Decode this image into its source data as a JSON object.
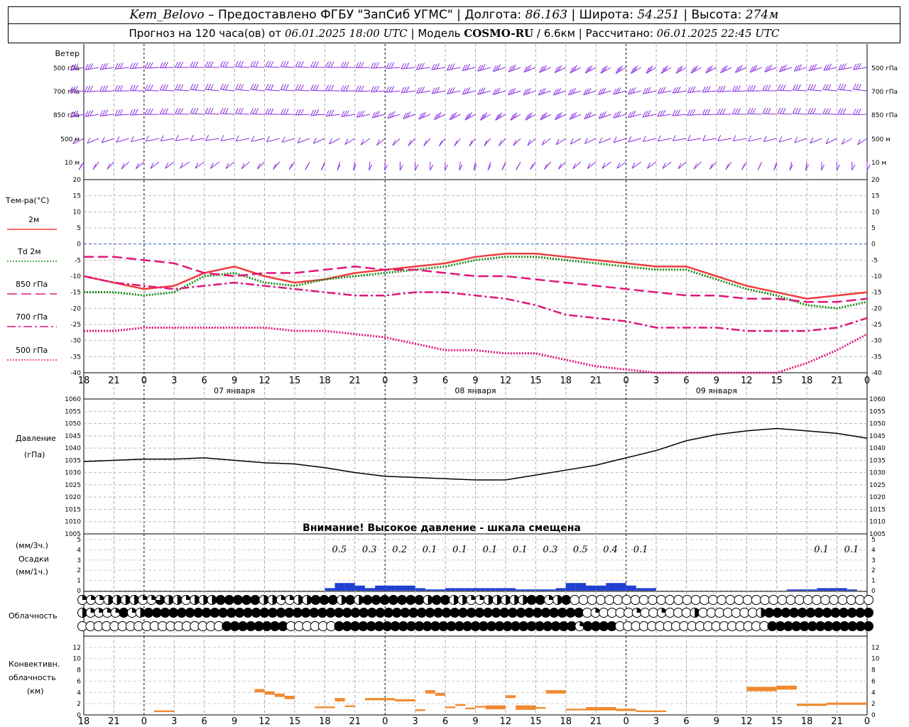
{
  "header": {
    "station": "Kem_Belovo",
    "provider": "– Предоставлено ФГБУ \"ЗапСиб УГМС\" |",
    "lon_label": "Долгота:",
    "lon": "86.163",
    "lat_label": "| Широта:",
    "lat": "54.251",
    "alt_label": "| Высота:",
    "alt": "274м",
    "forecast_prefix": "Прогноз на 120 часа(ов) от",
    "forecast_start": "06.01.2025 18:00 UTC",
    "model_label": "| Модель",
    "model_name": "COSMO-RU",
    "model_res": "/ 6.6км",
    "computed_label": "| Рассчитано:",
    "computed": "06.01.2025 22:45 UTC"
  },
  "chart_data": [
    {
      "type": "barbs",
      "title": "Ветер",
      "levels": [
        "500 гПа",
        "700 гПа",
        "850 гПа",
        "500 м",
        "10 м"
      ],
      "color": "#8a2be2"
    },
    {
      "type": "line",
      "ylabel": "Тем-ра(°C)",
      "ylim": [
        -40,
        20
      ],
      "yticks": [
        20,
        15,
        10,
        5,
        0,
        -5,
        -10,
        -15,
        -20,
        -25,
        -30,
        -35,
        -40
      ],
      "x_hours": [
        0,
        3,
        6,
        9,
        12,
        15,
        18,
        21,
        24,
        27,
        30,
        33,
        36,
        39,
        42,
        45,
        48,
        51,
        54,
        57,
        60,
        63,
        66,
        69,
        72,
        75,
        78
      ],
      "series": [
        {
          "name": "2м",
          "color": "#f03c3c",
          "style": "solid",
          "values": [
            -10,
            -12,
            -14,
            -13,
            -9,
            -7,
            -10,
            -12,
            -11,
            -9,
            -8,
            -7,
            -6,
            -4,
            -3,
            -3,
            -4,
            -5,
            -6,
            -7,
            -7,
            -10,
            -13,
            -15,
            -17,
            -16,
            -15
          ]
        },
        {
          "name": "Td 2м",
          "color": "#1a8a1a",
          "style": "dotted",
          "values": [
            -15,
            -15,
            -16,
            -15,
            -10,
            -9,
            -12,
            -13,
            -11,
            -10,
            -9,
            -8,
            -7,
            -5,
            -4,
            -4,
            -5,
            -6,
            -7,
            -8,
            -8,
            -11,
            -14,
            -16,
            -19,
            -20,
            -18
          ]
        },
        {
          "name": "850 гПа",
          "color": "#e0157a",
          "style": "dash",
          "values": [
            -4,
            -4,
            -5,
            -6,
            -9,
            -10,
            -9,
            -9,
            -8,
            -7,
            -8,
            -8,
            -9,
            -10,
            -10,
            -11,
            -12,
            -13,
            -14,
            -15,
            -16,
            -16,
            -17,
            -17,
            -18,
            -18,
            -17
          ]
        },
        {
          "name": "700 гПа",
          "color": "#e0157a",
          "style": "dashdot",
          "values": [
            -10,
            -12,
            -13,
            -14,
            -13,
            -12,
            -13,
            -14,
            -15,
            -16,
            -16,
            -15,
            -15,
            -16,
            -17,
            -19,
            -22,
            -23,
            -24,
            -26,
            -26,
            -26,
            -27,
            -27,
            -27,
            -26,
            -23
          ]
        },
        {
          "name": "500 гПа",
          "color": "#e0157a",
          "style": "dotted",
          "values": [
            -27,
            -27,
            -26,
            -26,
            -26,
            -26,
            -26,
            -27,
            -27,
            -28,
            -29,
            -31,
            -33,
            -33,
            -34,
            -34,
            -36,
            -38,
            -39,
            -40,
            -41,
            -42,
            -43,
            -40,
            -37,
            -33,
            -28
          ]
        }
      ]
    },
    {
      "type": "line",
      "ylabel": "Давление",
      "ylabel2": "(гПа)",
      "ylim": [
        1005,
        1060
      ],
      "yticks": [
        1060,
        1055,
        1050,
        1045,
        1040,
        1035,
        1030,
        1025,
        1020,
        1015,
        1010,
        1005
      ],
      "x_hours": [
        0,
        3,
        6,
        9,
        12,
        15,
        18,
        21,
        24,
        27,
        30,
        33,
        36,
        39,
        42,
        45,
        48,
        51,
        54,
        57,
        60,
        63,
        66,
        69,
        72,
        75,
        78
      ],
      "series": [
        {
          "name": "Давление",
          "color": "#000000",
          "values": [
            1034.5,
            1035,
            1035.5,
            1035.5,
            1036,
            1035,
            1034,
            1033.5,
            1032,
            1030,
            1028.5,
            1028,
            1027.5,
            1027,
            1027,
            1029,
            1031,
            1033,
            1036,
            1039,
            1043,
            1045.5,
            1047,
            1048,
            1047,
            1046,
            1044
          ]
        }
      ],
      "annotation": "Внимание! Высокое давление - шкала смещена"
    },
    {
      "type": "bar",
      "ylabel": "(мм/3ч.)",
      "ylabel2": "Осадки",
      "ylabel3": "(мм/1ч.)",
      "ylim": [
        0,
        5
      ],
      "yticks": [
        5,
        4,
        3,
        2,
        1,
        0
      ],
      "totals": [
        {
          "hour": 27,
          "value": "0.5"
        },
        {
          "hour": 30,
          "value": "0.3"
        },
        {
          "hour": 33,
          "value": "0.2"
        },
        {
          "hour": 36,
          "value": "0.1"
        },
        {
          "hour": 39,
          "value": "0.1"
        },
        {
          "hour": 42,
          "value": "0.1"
        },
        {
          "hour": 45,
          "value": "0.1"
        },
        {
          "hour": 48,
          "value": "0.3"
        },
        {
          "hour": 51,
          "value": "0.5"
        },
        {
          "hour": 54,
          "value": "0.4"
        },
        {
          "hour": 57,
          "value": "0.1"
        },
        {
          "hour": 75,
          "value": "0.1"
        },
        {
          "hour": 78,
          "value": "0.1"
        }
      ],
      "hourly_hours": [
        25,
        26,
        27,
        28,
        29,
        30,
        31,
        32,
        33,
        34,
        35,
        36,
        37,
        38,
        39,
        40,
        41,
        42,
        43,
        44,
        45,
        46,
        47,
        48,
        49,
        50,
        51,
        52,
        53,
        54,
        55,
        56,
        57,
        71,
        72,
        73,
        74,
        75,
        76,
        77
      ],
      "hourly_values": [
        0.1,
        0.3,
        0.3,
        0.2,
        0.1,
        0.2,
        0.2,
        0.2,
        0.2,
        0.1,
        0.05,
        0.05,
        0.1,
        0.1,
        0.1,
        0.1,
        0.1,
        0.1,
        0.1,
        0.05,
        0.05,
        0.05,
        0.05,
        0.1,
        0.3,
        0.3,
        0.2,
        0.2,
        0.3,
        0.3,
        0.2,
        0.1,
        0.1,
        0.05,
        0.05,
        0.05,
        0.1,
        0.1,
        0.1,
        0.05
      ],
      "color": "#2040d0"
    },
    {
      "type": "heatmap",
      "ylabel": "Облачность",
      "rows": [
        "qqqhhhhqqthhqhhhfffffhhqqhhfffhfhfffffffhffhhqqhhhhhffqhf00000000000000000000000000000000000",
        "hqqqqfqhfffffffffffffffffffffffffffffffffffffffffffffffffffff0q0000q00q000h0000000hfffffffffffff",
        "000000000000000000ffffffff000000ffffffffffffffffffffffffffffffqffff0000000000000000000fffffffffffff"
      ]
    },
    {
      "type": "bar",
      "ylabel": "Конвективн.",
      "ylabel2": "облачность",
      "ylabel3": "(км)",
      "ylim": [
        0,
        14
      ],
      "yticks": [
        12,
        10,
        8,
        6,
        4,
        2,
        0
      ],
      "color": "#f08a30",
      "segments": [
        {
          "h0": 7,
          "h1": 9,
          "bottom": 0.5,
          "top": 0.8
        },
        {
          "h0": 17,
          "h1": 18,
          "bottom": 4.0,
          "top": 4.6
        },
        {
          "h0": 18,
          "h1": 19,
          "bottom": 3.6,
          "top": 4.2
        },
        {
          "h0": 19,
          "h1": 20,
          "bottom": 3.2,
          "top": 3.8
        },
        {
          "h0": 20,
          "h1": 21,
          "bottom": 2.8,
          "top": 3.4
        },
        {
          "h0": 23,
          "h1": 25,
          "bottom": 1.2,
          "top": 1.5
        },
        {
          "h0": 25,
          "h1": 26,
          "bottom": 2.4,
          "top": 3.0
        },
        {
          "h0": 26,
          "h1": 27,
          "bottom": 1.4,
          "top": 1.7
        },
        {
          "h0": 28,
          "h1": 31,
          "bottom": 2.6,
          "top": 3.0
        },
        {
          "h0": 31,
          "h1": 33,
          "bottom": 2.4,
          "top": 2.8
        },
        {
          "h0": 33,
          "h1": 34,
          "bottom": 0.7,
          "top": 1.0
        },
        {
          "h0": 34,
          "h1": 35,
          "bottom": 3.8,
          "top": 4.4
        },
        {
          "h0": 35,
          "h1": 36,
          "bottom": 3.4,
          "top": 3.9
        },
        {
          "h0": 36,
          "h1": 37,
          "bottom": 1.2,
          "top": 1.5
        },
        {
          "h0": 37,
          "h1": 38,
          "bottom": 1.6,
          "top": 1.9
        },
        {
          "h0": 38,
          "h1": 39,
          "bottom": 1.0,
          "top": 1.3
        },
        {
          "h0": 39,
          "h1": 40,
          "bottom": 1.3,
          "top": 1.6
        },
        {
          "h0": 40,
          "h1": 42,
          "bottom": 1.0,
          "top": 1.7
        },
        {
          "h0": 42,
          "h1": 43,
          "bottom": 3.0,
          "top": 3.5
        },
        {
          "h0": 43,
          "h1": 45,
          "bottom": 0.9,
          "top": 1.7
        },
        {
          "h0": 45,
          "h1": 46,
          "bottom": 1.1,
          "top": 1.4
        },
        {
          "h0": 46,
          "h1": 48,
          "bottom": 3.8,
          "top": 4.4
        },
        {
          "h0": 48,
          "h1": 50,
          "bottom": 0.8,
          "top": 1.1
        },
        {
          "h0": 50,
          "h1": 53,
          "bottom": 0.8,
          "top": 1.4
        },
        {
          "h0": 53,
          "h1": 55,
          "bottom": 0.7,
          "top": 1.1
        },
        {
          "h0": 55,
          "h1": 58,
          "bottom": 0.5,
          "top": 0.8
        },
        {
          "h0": 66,
          "h1": 69,
          "bottom": 4.2,
          "top": 5.0
        },
        {
          "h0": 69,
          "h1": 71,
          "bottom": 4.5,
          "top": 5.2
        },
        {
          "h0": 71,
          "h1": 74,
          "bottom": 1.6,
          "top": 2.0
        },
        {
          "h0": 74,
          "h1": 78,
          "bottom": 1.8,
          "top": 2.2
        }
      ]
    }
  ],
  "x_axis": {
    "tick_labels": [
      "18",
      "21",
      "0",
      "3",
      "6",
      "9",
      "12",
      "15",
      "18",
      "21",
      "0",
      "3",
      "6",
      "9",
      "12",
      "15",
      "18",
      "21",
      "0",
      "3",
      "6",
      "9",
      "12",
      "15",
      "18",
      "21",
      "0"
    ],
    "day_labels": [
      {
        "hour": 15,
        "text": "07 января"
      },
      {
        "hour": 39,
        "text": "08 января"
      },
      {
        "hour": 63,
        "text": "09 января"
      }
    ]
  }
}
